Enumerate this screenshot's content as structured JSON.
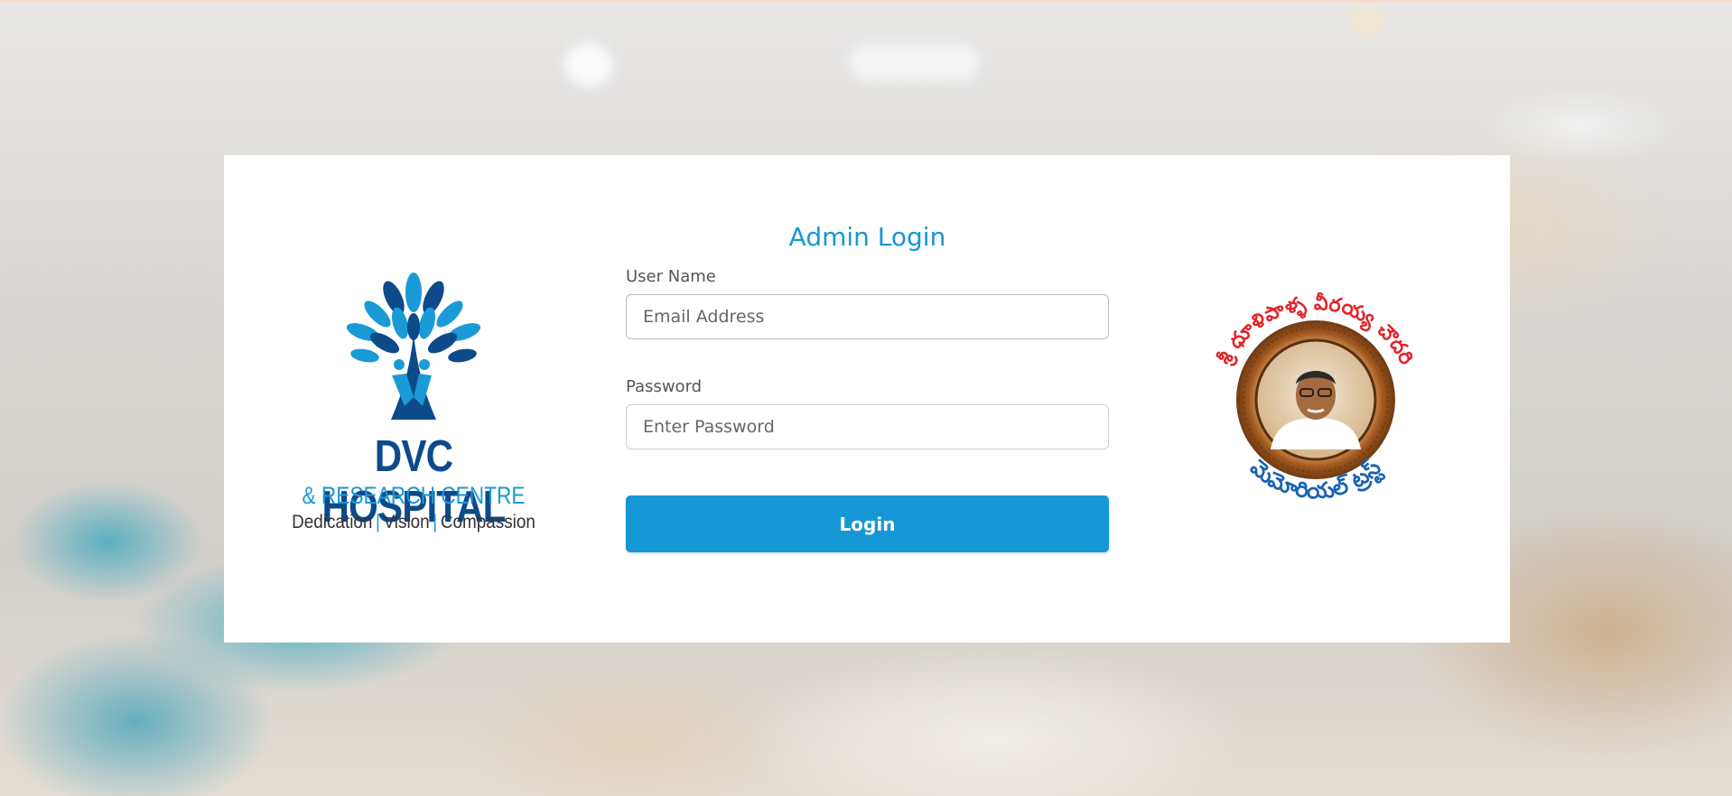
{
  "login": {
    "title": "Admin Login",
    "username_label": "User Name",
    "username_placeholder": "Email Address",
    "password_label": "Password",
    "password_placeholder": "Enter Password",
    "button_label": "Login"
  },
  "left_logo": {
    "name": "DVC HOSPITAL",
    "subtitle": "& RESEARCH CENTRE",
    "tagline_1": "Dedication",
    "tagline_2": "Vision",
    "tagline_3": "Compassion",
    "separator": "|"
  },
  "right_logo": {
    "icon": "memorial-trust-emblem-icon",
    "top_arc_text": "శ్రీ ధూళిపాళ్ళ వీరయ్య చౌదరి",
    "bottom_arc_text": "మెమోరియల్ ట్రస్ట్"
  },
  "colors": {
    "primary": "#1697d5",
    "logo_dark_blue": "#0d4a8a",
    "logo_light_blue": "#1a9ad6",
    "emblem_red": "#e2242b",
    "emblem_blue": "#1b63b0",
    "emblem_gold": "#b8702a"
  }
}
